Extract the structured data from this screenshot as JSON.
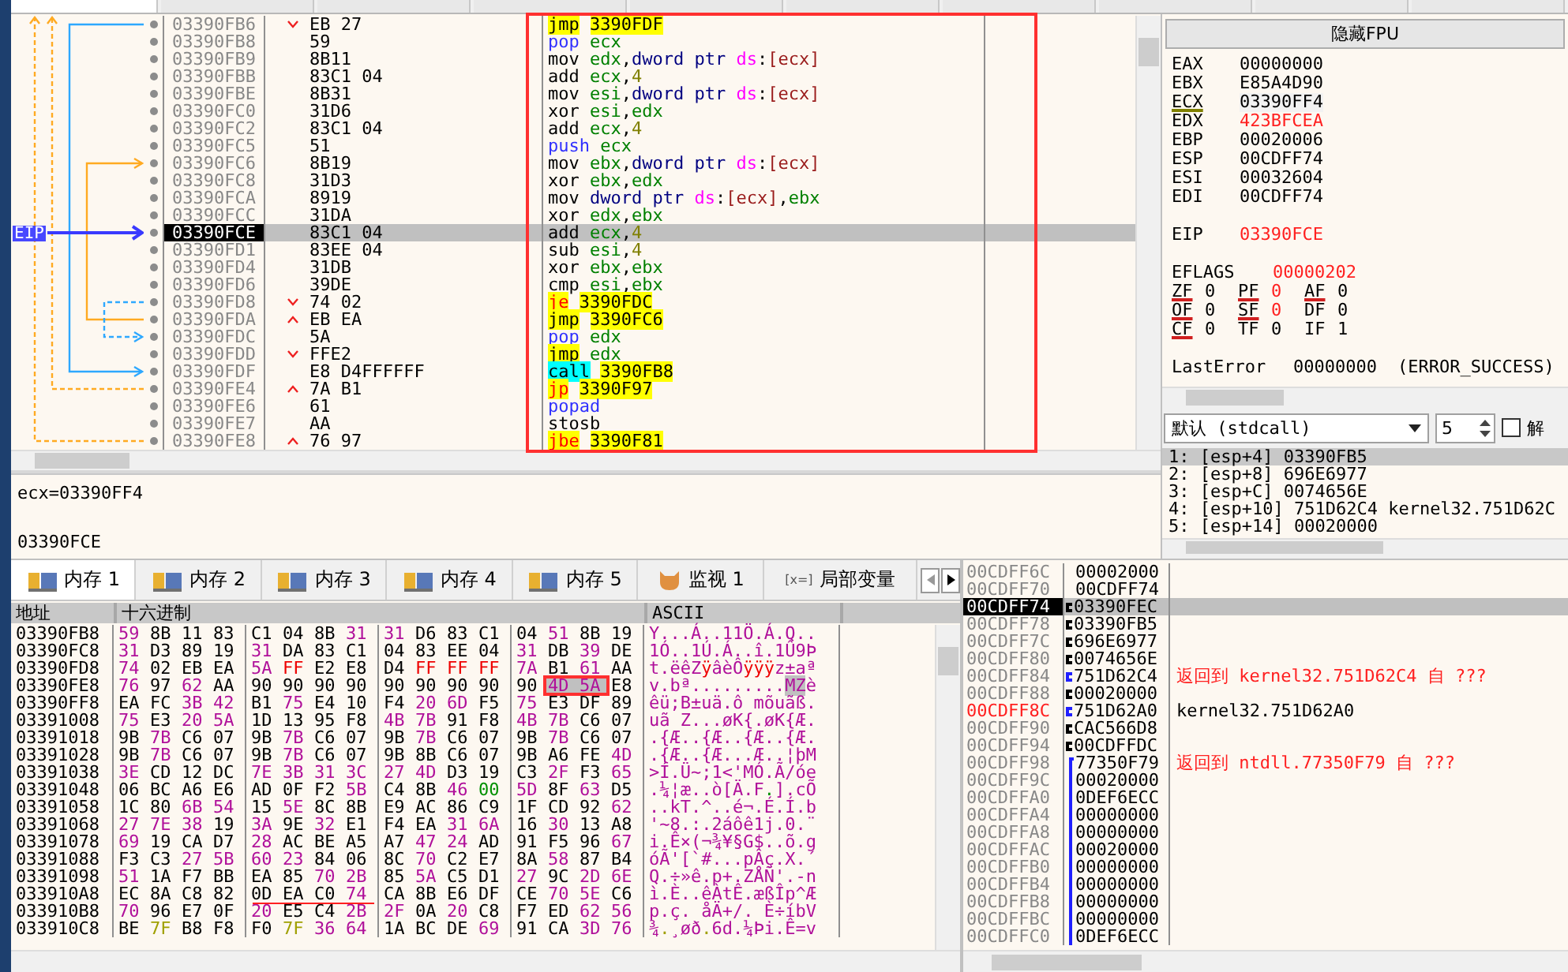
{
  "disassembly": {
    "eip_label": "EIP",
    "rows": [
      {
        "address": "03390FB6",
        "jump_marker": {
          "kind": "down"
        },
        "bytes": "EB 27",
        "mnemonic": {
          "text": "jmp",
          "kind": "jmp"
        },
        "operands": [
          {
            "text": "3390FDF",
            "kind": "address"
          }
        ],
        "selected": false
      },
      {
        "address": "03390FB8",
        "bytes": "59",
        "mnemonic": {
          "text": "pop",
          "kind": "stack"
        },
        "operands": [
          {
            "text": "ecx",
            "kind": "register"
          }
        ],
        "selected": false
      },
      {
        "address": "03390FB9",
        "bytes": "8B11",
        "mnemonic": {
          "text": "mov",
          "kind": "plain"
        },
        "operands": [
          {
            "text": "edx",
            "kind": "register"
          },
          {
            "text": ",",
            "kind": "punct"
          },
          {
            "text": "dword ptr ",
            "kind": "size"
          },
          {
            "text": "ds",
            "kind": "segment"
          },
          {
            "text": ":",
            "kind": "punct"
          },
          {
            "text": "[ecx]",
            "kind": "memory"
          }
        ],
        "selected": false
      },
      {
        "address": "03390FBB",
        "bytes": "83C1 04",
        "mnemonic": {
          "text": "add",
          "kind": "plain"
        },
        "operands": [
          {
            "text": "ecx",
            "kind": "register"
          },
          {
            "text": ",",
            "kind": "punct"
          },
          {
            "text": "4",
            "kind": "number"
          }
        ],
        "selected": false
      },
      {
        "address": "03390FBE",
        "bytes": "8B31",
        "mnemonic": {
          "text": "mov",
          "kind": "plain"
        },
        "operands": [
          {
            "text": "esi",
            "kind": "register"
          },
          {
            "text": ",",
            "kind": "punct"
          },
          {
            "text": "dword ptr ",
            "kind": "size"
          },
          {
            "text": "ds",
            "kind": "segment"
          },
          {
            "text": ":",
            "kind": "punct"
          },
          {
            "text": "[ecx]",
            "kind": "memory"
          }
        ],
        "selected": false
      },
      {
        "address": "03390FC0",
        "bytes": "31D6",
        "mnemonic": {
          "text": "xor",
          "kind": "plain"
        },
        "operands": [
          {
            "text": "esi",
            "kind": "register"
          },
          {
            "text": ",",
            "kind": "punct"
          },
          {
            "text": "edx",
            "kind": "register"
          }
        ],
        "selected": false
      },
      {
        "address": "03390FC2",
        "bytes": "83C1 04",
        "mnemonic": {
          "text": "add",
          "kind": "plain"
        },
        "operands": [
          {
            "text": "ecx",
            "kind": "register"
          },
          {
            "text": ",",
            "kind": "punct"
          },
          {
            "text": "4",
            "kind": "number"
          }
        ],
        "selected": false
      },
      {
        "address": "03390FC5",
        "bytes": "51",
        "mnemonic": {
          "text": "push",
          "kind": "stack"
        },
        "operands": [
          {
            "text": "ecx",
            "kind": "register"
          }
        ],
        "selected": false
      },
      {
        "address": "03390FC6",
        "bytes": "8B19",
        "mnemonic": {
          "text": "mov",
          "kind": "plain"
        },
        "operands": [
          {
            "text": "ebx",
            "kind": "register"
          },
          {
            "text": ",",
            "kind": "punct"
          },
          {
            "text": "dword ptr ",
            "kind": "size"
          },
          {
            "text": "ds",
            "kind": "segment"
          },
          {
            "text": ":",
            "kind": "punct"
          },
          {
            "text": "[ecx]",
            "kind": "memory"
          }
        ],
        "selected": false
      },
      {
        "address": "03390FC8",
        "bytes": "31D3",
        "mnemonic": {
          "text": "xor",
          "kind": "plain"
        },
        "operands": [
          {
            "text": "ebx",
            "kind": "register"
          },
          {
            "text": ",",
            "kind": "punct"
          },
          {
            "text": "edx",
            "kind": "register"
          }
        ],
        "selected": false
      },
      {
        "address": "03390FCA",
        "bytes": "8919",
        "mnemonic": {
          "text": "mov",
          "kind": "plain"
        },
        "operands": [
          {
            "text": "dword ptr ",
            "kind": "size"
          },
          {
            "text": "ds",
            "kind": "segment"
          },
          {
            "text": ":",
            "kind": "punct"
          },
          {
            "text": "[ecx]",
            "kind": "memory"
          },
          {
            "text": ",",
            "kind": "punct"
          },
          {
            "text": "ebx",
            "kind": "register"
          }
        ],
        "selected": false
      },
      {
        "address": "03390FCC",
        "bytes": "31DA",
        "mnemonic": {
          "text": "xor",
          "kind": "plain"
        },
        "operands": [
          {
            "text": "edx",
            "kind": "register"
          },
          {
            "text": ",",
            "kind": "punct"
          },
          {
            "text": "ebx",
            "kind": "register"
          }
        ],
        "selected": false
      },
      {
        "address": "03390FCE",
        "bytes": "83C1 04",
        "mnemonic": {
          "text": "add",
          "kind": "plain"
        },
        "operands": [
          {
            "text": "ecx",
            "kind": "register"
          },
          {
            "text": ",",
            "kind": "punct"
          },
          {
            "text": "4",
            "kind": "number"
          }
        ],
        "selected": true
      },
      {
        "address": "03390FD1",
        "bytes": "83EE 04",
        "mnemonic": {
          "text": "sub",
          "kind": "plain"
        },
        "operands": [
          {
            "text": "esi",
            "kind": "register"
          },
          {
            "text": ",",
            "kind": "punct"
          },
          {
            "text": "4",
            "kind": "number"
          }
        ],
        "selected": false
      },
      {
        "address": "03390FD4",
        "bytes": "31DB",
        "mnemonic": {
          "text": "xor",
          "kind": "plain"
        },
        "operands": [
          {
            "text": "ebx",
            "kind": "register"
          },
          {
            "text": ",",
            "kind": "punct"
          },
          {
            "text": "ebx",
            "kind": "register"
          }
        ],
        "selected": false
      },
      {
        "address": "03390FD6",
        "bytes": "39DE",
        "mnemonic": {
          "text": "cmp",
          "kind": "plain"
        },
        "operands": [
          {
            "text": "esi",
            "kind": "register"
          },
          {
            "text": ",",
            "kind": "punct"
          },
          {
            "text": "ebx",
            "kind": "register"
          }
        ],
        "selected": false
      },
      {
        "address": "03390FD8",
        "jump_marker": {
          "kind": "down"
        },
        "bytes": "74 02",
        "mnemonic": {
          "text": "je",
          "kind": "jcc"
        },
        "operands": [
          {
            "text": "3390FDC",
            "kind": "address"
          }
        ],
        "selected": false
      },
      {
        "address": "03390FDA",
        "jump_marker": {
          "kind": "up"
        },
        "bytes": "EB EA",
        "mnemonic": {
          "text": "jmp",
          "kind": "jmp"
        },
        "operands": [
          {
            "text": "3390FC6",
            "kind": "address"
          }
        ],
        "selected": false
      },
      {
        "address": "03390FDC",
        "bytes": "5A",
        "mnemonic": {
          "text": "pop",
          "kind": "stack"
        },
        "operands": [
          {
            "text": "edx",
            "kind": "register"
          }
        ],
        "selected": false
      },
      {
        "address": "03390FDD",
        "jump_marker": {
          "kind": "down"
        },
        "bytes": "FFE2",
        "mnemonic": {
          "text": "jmp",
          "kind": "jmp"
        },
        "operands": [
          {
            "text": "edx",
            "kind": "register"
          }
        ],
        "selected": false
      },
      {
        "address": "03390FDF",
        "bytes": "E8 D4FFFFFF",
        "mnemonic": {
          "text": "call",
          "kind": "call"
        },
        "operands": [
          {
            "text": "3390FB8",
            "kind": "address"
          }
        ],
        "selected": false
      },
      {
        "address": "03390FE4",
        "jump_marker": {
          "kind": "up"
        },
        "bytes": "7A B1",
        "mnemonic": {
          "text": "jp",
          "kind": "jcc"
        },
        "operands": [
          {
            "text": "3390F97",
            "kind": "address"
          }
        ],
        "selected": false
      },
      {
        "address": "03390FE6",
        "bytes": "61",
        "mnemonic": {
          "text": "popad",
          "kind": "stack"
        },
        "operands": [],
        "selected": false
      },
      {
        "address": "03390FE7",
        "bytes": "AA",
        "mnemonic": {
          "text": "stosb",
          "kind": "plain"
        },
        "operands": [],
        "selected": false
      },
      {
        "address": "03390FE8",
        "jump_marker": {
          "kind": "up"
        },
        "bytes": "76 97",
        "mnemonic": {
          "text": "jbe",
          "kind": "jcc"
        },
        "operands": [
          {
            "text": "3390F81",
            "kind": "address"
          }
        ],
        "selected": false
      }
    ]
  },
  "registers_panel": {
    "fpu_button": "隐藏FPU",
    "registers": [
      {
        "name": "EAX",
        "value": "00000000",
        "changed": false,
        "focused": false
      },
      {
        "name": "EBX",
        "value": "E85A4D90",
        "changed": false,
        "focused": false
      },
      {
        "name": "ECX",
        "value": "03390FF4",
        "changed": false,
        "focused": true
      },
      {
        "name": "EDX",
        "value": "423BFCEA",
        "changed": true,
        "focused": false
      },
      {
        "name": "EBP",
        "value": "00020006",
        "changed": false,
        "focused": false
      },
      {
        "name": "ESP",
        "value": "00CDFF74",
        "changed": false,
        "focused": false
      },
      {
        "name": "ESI",
        "value": "00032604",
        "changed": false,
        "focused": false
      },
      {
        "name": "EDI",
        "value": "00CDFF74",
        "changed": false,
        "focused": false
      }
    ],
    "eip": {
      "name": "EIP",
      "value": "03390FCE",
      "changed": true
    },
    "eflags": {
      "name": "EFLAGS",
      "value": "00000202",
      "changed": true
    },
    "flags": [
      {
        "name": "ZF",
        "value": "0",
        "changed": false,
        "underlined": true
      },
      {
        "name": "PF",
        "value": "0",
        "changed": true,
        "underlined": true
      },
      {
        "name": "AF",
        "value": "0",
        "changed": false,
        "underlined": true
      },
      {
        "name": "OF",
        "value": "0",
        "changed": false,
        "underlined": true
      },
      {
        "name": "SF",
        "value": "0",
        "changed": true,
        "underlined": true
      },
      {
        "name": "DF",
        "value": "0",
        "changed": false,
        "underlined": false
      },
      {
        "name": "CF",
        "value": "0",
        "changed": false,
        "underlined": true
      },
      {
        "name": "TF",
        "value": "0",
        "changed": false,
        "underlined": false
      },
      {
        "name": "IF",
        "value": "1",
        "changed": false,
        "underlined": false
      }
    ],
    "last_error": {
      "label": "LastError",
      "code": "00000000",
      "text": "(ERROR_SUCCESS)"
    }
  },
  "call_convention": {
    "dropdown": "默认 (stdcall)",
    "count": "5",
    "unlock": {
      "label": "解",
      "checked": false
    }
  },
  "arguments": [
    {
      "text": "1: [esp+4] 03390FB5",
      "selected": true
    },
    {
      "text": "2: [esp+8] 696E6977",
      "selected": false
    },
    {
      "text": "3: [esp+C] 0074656E",
      "selected": false
    },
    {
      "text": "4: [esp+10] 751D62C4 kernel32.751D62C",
      "selected": false
    },
    {
      "text": "5: [esp+14] 00020000",
      "selected": false
    }
  ],
  "info_panel": {
    "lines": [
      "ecx=03390FF4",
      "03390FCE"
    ]
  },
  "dump": {
    "tabs": [
      {
        "label": "内存 1",
        "kind": "memory",
        "selected": true
      },
      {
        "label": "内存 2",
        "kind": "memory",
        "selected": false
      },
      {
        "label": "内存 3",
        "kind": "memory",
        "selected": false
      },
      {
        "label": "内存 4",
        "kind": "memory",
        "selected": false
      },
      {
        "label": "内存 5",
        "kind": "memory",
        "selected": false
      },
      {
        "label": "监视 1",
        "kind": "watch",
        "selected": false
      },
      {
        "label": "局部变量",
        "kind": "locals",
        "icon_text": "[x=]",
        "selected": false
      }
    ],
    "columns": [
      "地址",
      "十六进制",
      "ASCII"
    ],
    "rows": [
      {
        "address": "03390FB8",
        "bytes": [
          "59",
          "8B",
          "11",
          "83",
          "C1",
          "04",
          "8B",
          "31",
          "31",
          "D6",
          "83",
          "C1",
          "04",
          "51",
          "8B",
          "19"
        ],
        "ascii": "Y...Á..11Ö.Á.Q.."
      },
      {
        "address": "03390FC8",
        "bytes": [
          "31",
          "D3",
          "89",
          "19",
          "31",
          "DA",
          "83",
          "C1",
          "04",
          "83",
          "EE",
          "04",
          "31",
          "DB",
          "39",
          "DE"
        ],
        "ascii": "1Ó..1Ú.Á..î.1Û9Þ"
      },
      {
        "address": "03390FD8",
        "bytes": [
          "74",
          "02",
          "EB",
          "EA",
          "5A",
          "FF",
          "E2",
          "E8",
          "D4",
          "FF",
          "FF",
          "FF",
          "7A",
          "B1",
          "61",
          "AA"
        ],
        "ascii": "t.ëêZÿâèÔÿÿÿz±aª"
      },
      {
        "address": "03390FE8",
        "bytes": [
          "76",
          "97",
          "62",
          "AA",
          "90",
          "90",
          "90",
          "90",
          "90",
          "90",
          "90",
          "90",
          "90",
          {
            "text": "4D",
            "selected": true
          },
          {
            "text": "5A",
            "selected": true
          },
          "E8"
        ],
        "ascii": [
          {
            "text": "v.bª.........",
            "selected": false
          },
          {
            "text": "MZ",
            "selected": true
          },
          {
            "text": "è",
            "selected": false
          }
        ]
      },
      {
        "address": "03390FF8",
        "bytes": [
          "EA",
          "FC",
          "3B",
          "42",
          "B1",
          "75",
          "E4",
          "10",
          "F4",
          "20",
          "6D",
          "F5",
          "75",
          "E3",
          "DF",
          "89"
        ],
        "ascii": "êü;B±uä.ô mõuãß."
      },
      {
        "address": "03391008",
        "bytes": [
          "75",
          "E3",
          "20",
          "5A",
          "1D",
          "13",
          "95",
          "F8",
          "4B",
          "7B",
          "91",
          "F8",
          "4B",
          "7B",
          "C6",
          "07"
        ],
        "ascii": "uã Z...øK{.øK{Æ."
      },
      {
        "address": "03391018",
        "bytes": [
          "9B",
          "7B",
          "C6",
          "07",
          "9B",
          "7B",
          "C6",
          "07",
          "9B",
          "7B",
          "C6",
          "07",
          "9B",
          "7B",
          "C6",
          "07"
        ],
        "ascii": ".{Æ..{Æ..{Æ..{Æ."
      },
      {
        "address": "03391028",
        "bytes": [
          "9B",
          "7B",
          "C6",
          "07",
          "9B",
          "7B",
          "C6",
          "07",
          "9B",
          "8B",
          "C6",
          "07",
          "9B",
          "A6",
          "FE",
          "4D"
        ],
        "ascii": ".{Æ..{Æ...Æ..¦þM"
      },
      {
        "address": "03391038",
        "bytes": [
          "3E",
          "CD",
          "12",
          "DC",
          "7E",
          "3B",
          "31",
          "3C",
          "27",
          "4D",
          "D3",
          "19",
          "C3",
          "2F",
          "F3",
          "65"
        ],
        "ascii": ">Í.Ü~;1<'MÓ.Ã/óe"
      },
      {
        "address": "03391048",
        "bytes": [
          "06",
          "BC",
          "A6",
          "E6",
          "AD",
          "0F",
          "F2",
          "5B",
          "C4",
          "8B",
          "46",
          "00",
          "5D",
          "8F",
          "63",
          "D5"
        ],
        "ascii": ".¼¦æ..ò[Ä.F.].cÕ"
      },
      {
        "address": "03391058",
        "bytes": [
          "1C",
          "80",
          "6B",
          "54",
          "15",
          "5E",
          "8C",
          "8B",
          "E9",
          "AC",
          "86",
          "C9",
          "1F",
          "CD",
          "92",
          "62"
        ],
        "ascii": "..kT.^..é¬.É.Í.b"
      },
      {
        "address": "03391068",
        "bytes": [
          "27",
          "7E",
          "38",
          "19",
          "3A",
          "9E",
          "32",
          "E1",
          "F4",
          "EA",
          "31",
          "6A",
          "16",
          "30",
          "13",
          "A8"
        ],
        "ascii": "'~8.:.2áôê1j.0.¨"
      },
      {
        "address": "03391078",
        "bytes": [
          "69",
          "19",
          "CA",
          "D7",
          "28",
          "AC",
          "BE",
          "A5",
          "A7",
          "47",
          "24",
          "AD",
          "91",
          "F5",
          "96",
          "67"
        ],
        "ascii": "i.Ê×(¬¾¥§G$..õ.g"
      },
      {
        "address": "03391088",
        "bytes": [
          "F3",
          "C3",
          "27",
          "5B",
          "60",
          "23",
          "84",
          "06",
          "8C",
          "70",
          "C2",
          "E7",
          "8A",
          "58",
          "87",
          "B4"
        ],
        "ascii": "óÃ'[`#...pÂç.X.´"
      },
      {
        "address": "03391098",
        "bytes": [
          "51",
          "1A",
          "F7",
          "BB",
          "EA",
          "85",
          "70",
          "2B",
          "85",
          "5A",
          "C5",
          "D1",
          "27",
          "9C",
          "2D",
          "6E"
        ],
        "ascii": "Q.÷»ê.p+.ZÅÑ'.-n"
      },
      {
        "address": "033910A8",
        "bytes": [
          "EC",
          "8A",
          "C8",
          "82",
          "0D",
          "EA",
          "C0",
          "74",
          "CA",
          "8B",
          "E6",
          "DF",
          "CE",
          "70",
          "5E",
          "C6"
        ],
        "ascii": "ì.È..êÀtÊ.æßÎp^Æ"
      },
      {
        "address": "033910B8",
        "bytes": [
          "70",
          "96",
          "E7",
          "0F",
          "20",
          "E5",
          "C4",
          "2B",
          "2F",
          "0A",
          "20",
          "C8",
          "F7",
          "ED",
          "62",
          "56"
        ],
        "ascii": "p.ç. åÄ+/. È÷íbV"
      },
      {
        "address": "033910C8",
        "bytes": [
          "BE",
          "7F",
          "B8",
          "F8",
          "F0",
          "7F",
          "36",
          "64",
          "1A",
          "BC",
          "DE",
          "69",
          "91",
          "CA",
          "3D",
          "76"
        ],
        "ascii": "¾.¸øð.6d.¼Þi.Ê=v"
      }
    ]
  },
  "stack": {
    "rows": [
      {
        "address": "00CDFF6C",
        "value": "00002000",
        "selected": false,
        "flagged": false
      },
      {
        "address": "00CDFF70",
        "value": "00CDFF74",
        "selected": false,
        "flagged": false
      },
      {
        "address": "00CDFF74",
        "value": "03390FEC",
        "marker": {
          "kind": "ptr"
        },
        "selected": true,
        "flagged": false
      },
      {
        "address": "00CDFF78",
        "value": "03390FB5",
        "marker": {
          "kind": "ptr"
        },
        "selected": false,
        "flagged": false
      },
      {
        "address": "00CDFF7C",
        "value": "696E6977",
        "marker": {
          "kind": "ptr"
        },
        "selected": false,
        "flagged": false
      },
      {
        "address": "00CDFF80",
        "value": "0074656E",
        "marker": {
          "kind": "ptr"
        },
        "selected": false,
        "flagged": false
      },
      {
        "address": "00CDFF84",
        "value": "751D62C4",
        "marker": {
          "kind": "ret"
        },
        "selected": false,
        "flagged": false,
        "comment": {
          "kind": "return",
          "text": "返回到 kernel32.751D62C4 自 ???"
        }
      },
      {
        "address": "00CDFF88",
        "value": "00020000",
        "marker": {
          "kind": "ptr"
        },
        "selected": false,
        "flagged": false
      },
      {
        "address": "00CDFF8C",
        "value": "751D62A0",
        "marker": {
          "kind": "ret"
        },
        "selected": false,
        "flagged": true,
        "comment": {
          "kind": "label",
          "text": "kernel32.751D62A0"
        }
      },
      {
        "address": "00CDFF90",
        "value": "CAC566D8",
        "marker": {
          "kind": "ptr"
        },
        "selected": false,
        "flagged": false
      },
      {
        "address": "00CDFF94",
        "value": "00CDFFDC",
        "marker": {
          "kind": "ptr"
        },
        "selected": false,
        "flagged": false
      },
      {
        "address": "00CDFF98",
        "value": "77350F79",
        "marker": {
          "kind": "frame"
        },
        "selected": false,
        "flagged": false,
        "comment": {
          "kind": "return",
          "text": "返回到 ntdll.77350F79 自 ???"
        }
      },
      {
        "address": "00CDFF9C",
        "value": "00020000",
        "marker": {
          "kind": "frame"
        },
        "selected": false,
        "flagged": false
      },
      {
        "address": "00CDFFA0",
        "value": "0DEF6ECC",
        "marker": {
          "kind": "frame"
        },
        "selected": false,
        "flagged": false
      },
      {
        "address": "00CDFFA4",
        "value": "00000000",
        "marker": {
          "kind": "frame"
        },
        "selected": false,
        "flagged": false
      },
      {
        "address": "00CDFFA8",
        "value": "00000000",
        "marker": {
          "kind": "frame"
        },
        "selected": false,
        "flagged": false
      },
      {
        "address": "00CDFFAC",
        "value": "00020000",
        "marker": {
          "kind": "frame"
        },
        "selected": false,
        "flagged": false
      },
      {
        "address": "00CDFFB0",
        "value": "00000000",
        "marker": {
          "kind": "frame"
        },
        "selected": false,
        "flagged": false
      },
      {
        "address": "00CDFFB4",
        "value": "00000000",
        "marker": {
          "kind": "frame"
        },
        "selected": false,
        "flagged": false
      },
      {
        "address": "00CDFFB8",
        "value": "00000000",
        "marker": {
          "kind": "frame"
        },
        "selected": false,
        "flagged": false
      },
      {
        "address": "00CDFFBC",
        "value": "00000000",
        "marker": {
          "kind": "frame"
        },
        "selected": false,
        "flagged": false
      },
      {
        "address": "00CDFFC0",
        "value": "0DEF6ECC",
        "marker": {
          "kind": "frame"
        },
        "selected": false,
        "flagged": false
      }
    ]
  }
}
